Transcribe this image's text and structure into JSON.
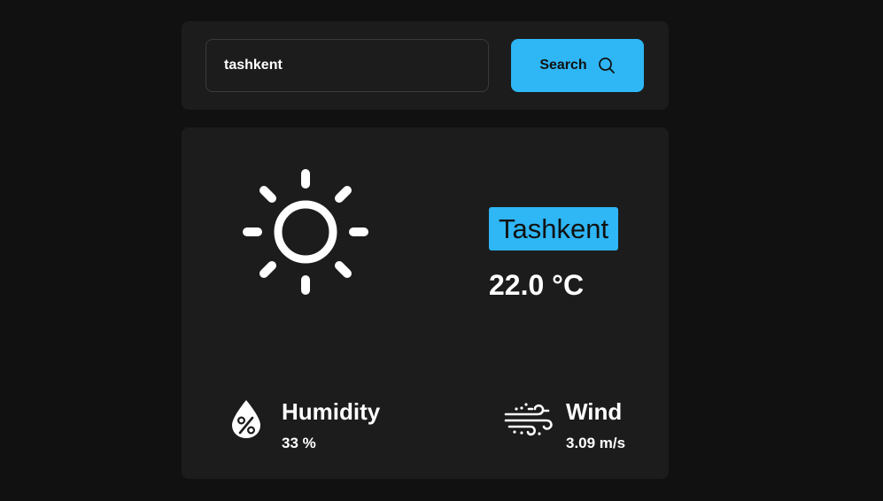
{
  "search": {
    "value": "tashkent",
    "button_label": "Search",
    "button_icon": "search-icon"
  },
  "weather": {
    "condition_icon": "sun-icon",
    "city": "Tashkent",
    "temperature": "22.0 °C",
    "humidity": {
      "icon": "humidity-icon",
      "title": "Humidity",
      "value": "33 %"
    },
    "wind": {
      "icon": "wind-icon",
      "title": "Wind",
      "value": "3.09 m/s"
    }
  },
  "colors": {
    "background": "#111111",
    "card": "#1c1c1c",
    "accent": "#2eb6f5",
    "text": "#ffffff"
  }
}
